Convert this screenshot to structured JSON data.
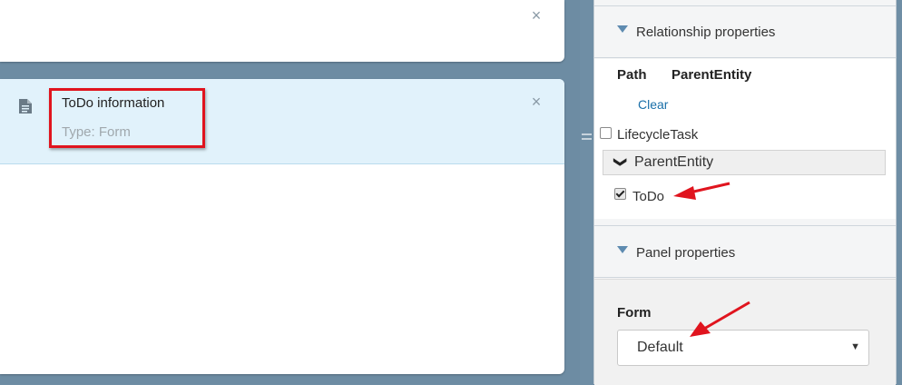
{
  "canvas": {
    "top_card": {
      "close_glyph": "×"
    },
    "selected_item": {
      "icon": "document-icon",
      "title": "ToDo information",
      "subtitle": "Type: Form",
      "close_glyph": "×",
      "highlight_color": "#e0141e"
    }
  },
  "properties": {
    "relationship": {
      "header": "Relationship properties",
      "columns": [
        "Path",
        "ParentEntity"
      ],
      "clear_label": "Clear",
      "items": [
        {
          "label": "LifecycleTask",
          "checked": false
        }
      ],
      "group": {
        "label": "ParentEntity",
        "expand_glyph": "❯",
        "items": [
          {
            "label": "ToDo",
            "checked": true
          }
        ]
      }
    },
    "panel": {
      "header": "Panel properties",
      "form_label": "Form",
      "form_value": "Default",
      "dropdown_glyph": "▼"
    }
  },
  "colors": {
    "accent_blue": "#1a6fa8",
    "header_bg": "#e1f2fb",
    "annotation_red": "#e0141e"
  }
}
